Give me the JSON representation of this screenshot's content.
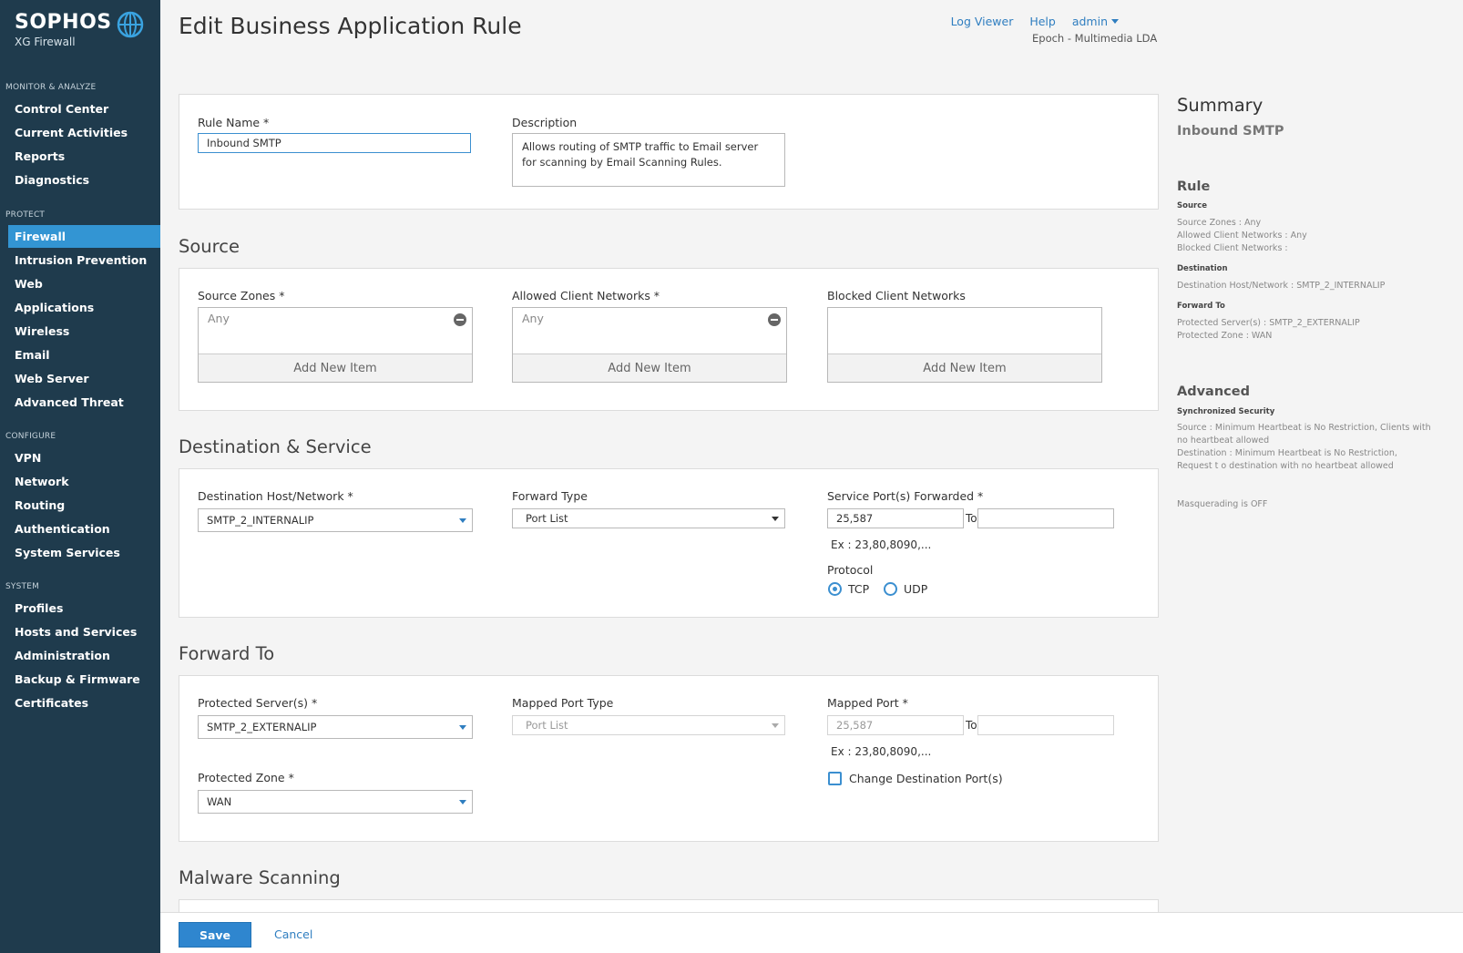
{
  "brand": {
    "name": "SOPHOS",
    "product": "XG Firewall"
  },
  "sidebar": {
    "sections": [
      {
        "title": "MONITOR & ANALYZE",
        "items": [
          "Control Center",
          "Current Activities",
          "Reports",
          "Diagnostics"
        ]
      },
      {
        "title": "PROTECT",
        "items": [
          "Firewall",
          "Intrusion Prevention",
          "Web",
          "Applications",
          "Wireless",
          "Email",
          "Web Server",
          "Advanced Threat"
        ]
      },
      {
        "title": "CONFIGURE",
        "items": [
          "VPN",
          "Network",
          "Routing",
          "Authentication",
          "System Services"
        ]
      },
      {
        "title": "SYSTEM",
        "items": [
          "Profiles",
          "Hosts and Services",
          "Administration",
          "Backup & Firmware",
          "Certificates"
        ]
      }
    ],
    "active": "Firewall"
  },
  "header": {
    "title": "Edit Business Application Rule",
    "links": {
      "log_viewer": "Log Viewer",
      "help": "Help",
      "user": "admin"
    },
    "org": "Epoch - Multimedia LDA"
  },
  "general": {
    "rule_name_label": "Rule Name *",
    "rule_name_value": "Inbound SMTP",
    "description_label": "Description",
    "description_value": "Allows routing of SMTP traffic to Email server for scanning by Email Scanning Rules."
  },
  "source": {
    "title": "Source",
    "source_zones_label": "Source Zones *",
    "source_zones_item": "Any",
    "allowed_label": "Allowed Client Networks *",
    "allowed_item": "Any",
    "blocked_label": "Blocked Client Networks",
    "add_new_item": "Add New Item"
  },
  "destination": {
    "title": "Destination & Service",
    "host_label": "Destination Host/Network *",
    "host_value": "SMTP_2_INTERNALIP",
    "forward_type_label": "Forward Type",
    "forward_type_value": "Port List",
    "ports_label": "Service Port(s) Forwarded *",
    "ports_value": "25,587",
    "to_label": "To",
    "hint": "Ex : 23,80,8090,...",
    "protocol_label": "Protocol",
    "protocol_tcp": "TCP",
    "protocol_udp": "UDP"
  },
  "forward_to": {
    "title": "Forward To",
    "servers_label": "Protected Server(s) *",
    "servers_value": "SMTP_2_EXTERNALIP",
    "mapped_type_label": "Mapped Port Type",
    "mapped_type_value": "Port List",
    "mapped_port_label": "Mapped Port *",
    "mapped_port_value": "25,587",
    "to_label": "To",
    "hint": "Ex : 23,80,8090,...",
    "change_dest_label": "Change Destination Port(s)",
    "zone_label": "Protected Zone *",
    "zone_value": "WAN"
  },
  "malware": {
    "title": "Malware Scanning"
  },
  "summary": {
    "title": "Summary",
    "rule_name": "Inbound SMTP",
    "rule_heading": "Rule",
    "source_heading": "Source",
    "source_zones": "Source Zones : Any",
    "allowed_networks": "Allowed Client Networks : Any",
    "blocked_networks": "Blocked Client Networks :",
    "destination_heading": "Destination",
    "destination_host": "Destination Host/Network : SMTP_2_INTERNALIP",
    "forward_heading": "Forward To",
    "protected_servers": "Protected Server(s) : SMTP_2_EXTERNALIP",
    "protected_zone": "Protected Zone : WAN",
    "advanced_heading": "Advanced",
    "sync_heading": "Synchronized Security",
    "sync_source": "Source : Minimum Heartbeat is No Restriction, Clients with no heartbeat allowed",
    "sync_destination": "Destination : Minimum Heartbeat is No Restriction, Request t o destination with no heartbeat allowed",
    "masquerading": "Masquerading is OFF"
  },
  "footer": {
    "save": "Save",
    "cancel": "Cancel"
  },
  "colors": {
    "sidebar_bg": "#1f3b4d",
    "active_nav": "#3395d3",
    "accent": "#2f86cf"
  }
}
